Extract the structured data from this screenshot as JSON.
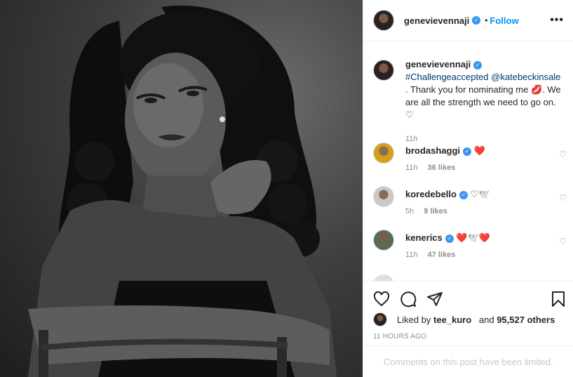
{
  "header": {
    "username": "genevievennaji",
    "dot": "•",
    "follow_label": "Follow",
    "more_label": "•••"
  },
  "caption": {
    "username": "genevievennaji",
    "hashtag": "#Challengeaccepted",
    "mention": "@katebeckinsale",
    "text": ". Thank you for nominating me 💋. We are all the strength we need to go on. ♡",
    "time": "11h"
  },
  "comments": [
    {
      "username": "brodashaggi",
      "text": "❤️",
      "time": "11h",
      "likes": "36 likes",
      "avatar_color": "#d4a017"
    },
    {
      "username": "koredebello",
      "text": "♡🕊️",
      "time": "5h",
      "likes": "9 likes",
      "avatar_color": "#c9c9c9"
    },
    {
      "username": "kenerics",
      "text": "❤️🕊️❤️",
      "time": "11h",
      "likes": "47 likes",
      "avatar_color": "#5a6b55"
    }
  ],
  "liked_by": {
    "prefix": "Liked by",
    "user": "tee_kuro",
    "middle": "and",
    "count": "95,527 others"
  },
  "post_time": "11 HOURS AGO",
  "comments_limited": "Comments on this post have been limited.",
  "icons": [
    "heart-icon",
    "comment-icon",
    "share-icon",
    "bookmark-icon",
    "verified-icon"
  ],
  "colors": {
    "link": "#00376b",
    "follow": "#0095f6",
    "verified": "#3897f0",
    "meta": "#8e8e8e",
    "heart": "#ed4956"
  }
}
